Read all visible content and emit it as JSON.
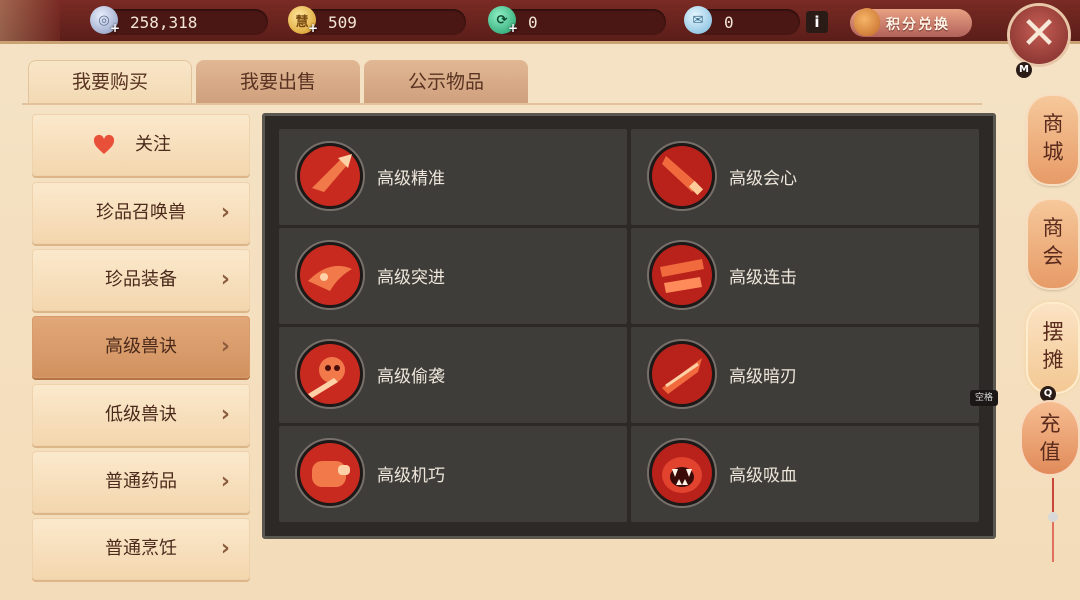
{
  "currencies": [
    {
      "name": "silver",
      "value": "258,318",
      "color": "#9fb3d6"
    },
    {
      "name": "gold",
      "value": "509",
      "color": "#e9b43a",
      "glyph": "慧"
    },
    {
      "name": "jade",
      "value": "0",
      "color": "#3fbf8a"
    },
    {
      "name": "ticket",
      "value": "0",
      "color": "#9fd0ef"
    }
  ],
  "info_label": "i",
  "points_exchange_label": "积分兑换",
  "close_key": "M",
  "tabs": [
    {
      "label": "我要购买",
      "active": true
    },
    {
      "label": "我要出售",
      "active": false
    },
    {
      "label": "公示物品",
      "active": false
    }
  ],
  "sidebar": [
    {
      "label": "关注",
      "type": "favorite",
      "active": false
    },
    {
      "label": "珍品召唤兽",
      "active": false
    },
    {
      "label": "珍品装备",
      "active": false
    },
    {
      "label": "高级兽诀",
      "active": true
    },
    {
      "label": "低级兽诀",
      "active": false
    },
    {
      "label": "普通药品",
      "active": false
    },
    {
      "label": "普通烹饪",
      "active": false
    }
  ],
  "skills": [
    {
      "name": "高级精准",
      "icon": "accuracy-icon"
    },
    {
      "name": "高级会心",
      "icon": "critical-icon"
    },
    {
      "name": "高级突进",
      "icon": "charge-icon"
    },
    {
      "name": "高级连击",
      "icon": "combo-icon"
    },
    {
      "name": "高级偷袭",
      "icon": "sneak-attack-icon"
    },
    {
      "name": "高级暗刃",
      "icon": "dark-blade-icon"
    },
    {
      "name": "高级机巧",
      "icon": "ingenuity-icon"
    },
    {
      "name": "高级吸血",
      "icon": "lifesteal-icon"
    }
  ],
  "rail": [
    {
      "label": "商城",
      "active": false
    },
    {
      "label": "商会",
      "active": false
    },
    {
      "label": "摆摊",
      "active": true,
      "key": "Q"
    },
    {
      "label": "充值",
      "active": false
    }
  ],
  "space_hint": "空格",
  "colors": {
    "accent": "#d1915f",
    "panel": "#2c2926",
    "skill_red": "#d8362a"
  }
}
